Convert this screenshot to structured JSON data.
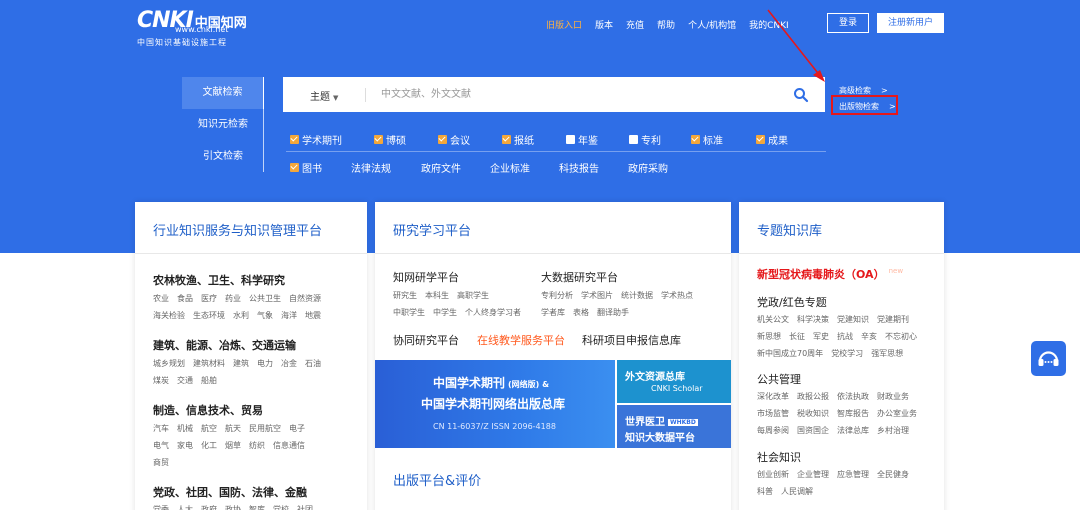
{
  "header": {
    "logo_brand": "CNKI",
    "logo_cn": "中国知网",
    "logo_url": "www.cnki.net",
    "logo_sub": "中国知识基础设施工程",
    "nav": [
      {
        "label": "旧版入口",
        "highlight": true
      },
      {
        "label": "版本",
        "highlight": false
      },
      {
        "label": "充值",
        "highlight": false
      },
      {
        "label": "帮助",
        "highlight": false
      },
      {
        "label": "个人/机构馆",
        "highlight": false
      },
      {
        "label": "我的CNKI",
        "highlight": false
      }
    ],
    "login": "登录",
    "register": "注册新用户"
  },
  "colors": {
    "primary": "#2f6ee6",
    "accent_orange": "#f3a73b",
    "highlight_red": "#e5181b",
    "link_orange": "#ff5a1f"
  },
  "search": {
    "tabs": [
      "文献检索",
      "知识元检索",
      "引文检索"
    ],
    "field": "主题",
    "placeholder": "中文文献、外文文献",
    "advanced": "高级检索",
    "publication": "出版物检索",
    "filters_row1": [
      {
        "label": "学术期刊",
        "checked": true
      },
      {
        "label": "博硕",
        "checked": true
      },
      {
        "label": "会议",
        "checked": true
      },
      {
        "label": "报纸",
        "checked": true
      },
      {
        "label": "年鉴",
        "checked": false
      },
      {
        "label": "专利",
        "checked": false
      },
      {
        "label": "标准",
        "checked": true
      },
      {
        "label": "成果",
        "checked": true
      }
    ],
    "filters_row2": [
      {
        "label": "图书",
        "checked": true
      },
      {
        "label": "法律法规"
      },
      {
        "label": "政府文件"
      },
      {
        "label": "企业标准"
      },
      {
        "label": "科技报告"
      },
      {
        "label": "政府采购"
      }
    ]
  },
  "card1": {
    "title": "行业知识服务与知识管理平台",
    "sections": [
      {
        "title": "农林牧渔、卫生、科学研究",
        "lines": [
          [
            "农业",
            "食品",
            "医疗",
            "药业",
            "公共卫生",
            "自然资源"
          ],
          [
            "海关检验",
            "生态环境",
            "水利",
            "气象",
            "海洋",
            "地震"
          ]
        ]
      },
      {
        "title": "建筑、能源、冶炼、交通运输",
        "lines": [
          [
            "城乡规划",
            "建筑材料",
            "建筑",
            "电力",
            "冶金",
            "石油"
          ],
          [
            "煤炭",
            "交通",
            "船舶"
          ]
        ]
      },
      {
        "title": "制造、信息技术、贸易",
        "lines": [
          [
            "汽车",
            "机械",
            "航空",
            "航天",
            "民用航空",
            "电子"
          ],
          [
            "电气",
            "家电",
            "化工",
            "烟草",
            "纺织",
            "信息通信"
          ],
          [
            "商贸"
          ]
        ]
      },
      {
        "title": "党政、社团、国防、法律、金融",
        "lines": [
          [
            "党委",
            "人大",
            "政府",
            "政协",
            "智库",
            "党校",
            "社团"
          ]
        ]
      }
    ]
  },
  "card2": {
    "title": "研究学习平台",
    "left_title": "知网研学平台",
    "left_lines": [
      [
        "研究生",
        "本科生",
        "高职学生"
      ],
      [
        "中职学生",
        "中学生",
        "个人终身学习者"
      ]
    ],
    "right_title": "大数据研究平台",
    "right_lines": [
      [
        "专利分析",
        "学术图片",
        "统计数据",
        "学术热点"
      ],
      [
        "学者库",
        "表格",
        "翻译助手"
      ]
    ],
    "row_items": [
      {
        "label": "协同研究平台",
        "highlight": false
      },
      {
        "label": "在线教学服务平台",
        "highlight": true
      },
      {
        "label": "科研项目申报信息库",
        "highlight": false
      }
    ],
    "banner_main_1": "中国学术期刊",
    "banner_main_1b": "(网络版) &",
    "banner_main_2": "中国学术期刊网络出版总库",
    "banner_main_3": "CN 11-6037/Z    ISSN 2096-4188",
    "banner_r1_title": "外文资源总库",
    "banner_r1_sub": "CNKI Scholar",
    "banner_r2_title": "世界医卫",
    "banner_r2_badge": "WHKBD",
    "banner_r2_sub": "知识大数据平台",
    "bottom_title": "出版平台&评价"
  },
  "card3": {
    "title": "专题知识库",
    "covid": "新型冠状病毒肺炎（OA）",
    "covid_badge": "new",
    "sections": [
      {
        "title": "党政/红色专题",
        "lines": [
          [
            "机关公文",
            "科学决策",
            "党建知识",
            "党建期刊"
          ],
          [
            "新思想",
            "长征",
            "军史",
            "抗战",
            "辛亥",
            "不忘初心"
          ],
          [
            "新中国成立70周年",
            "党校学习",
            "强军思想"
          ]
        ]
      },
      {
        "title": "公共管理",
        "lines": [
          [
            "深化改革",
            "政报公报",
            "依法执政",
            "财政业务"
          ],
          [
            "市场监管",
            "税收知识",
            "智库报告",
            "办公室业务"
          ],
          [
            "每周参阅",
            "国资国企",
            "法律总库",
            "乡村治理"
          ]
        ]
      },
      {
        "title": "社会知识",
        "lines": [
          [
            "创业创新",
            "企业管理",
            "应急管理",
            "全民健身"
          ],
          [
            "科普",
            "人民调解"
          ]
        ]
      }
    ]
  }
}
